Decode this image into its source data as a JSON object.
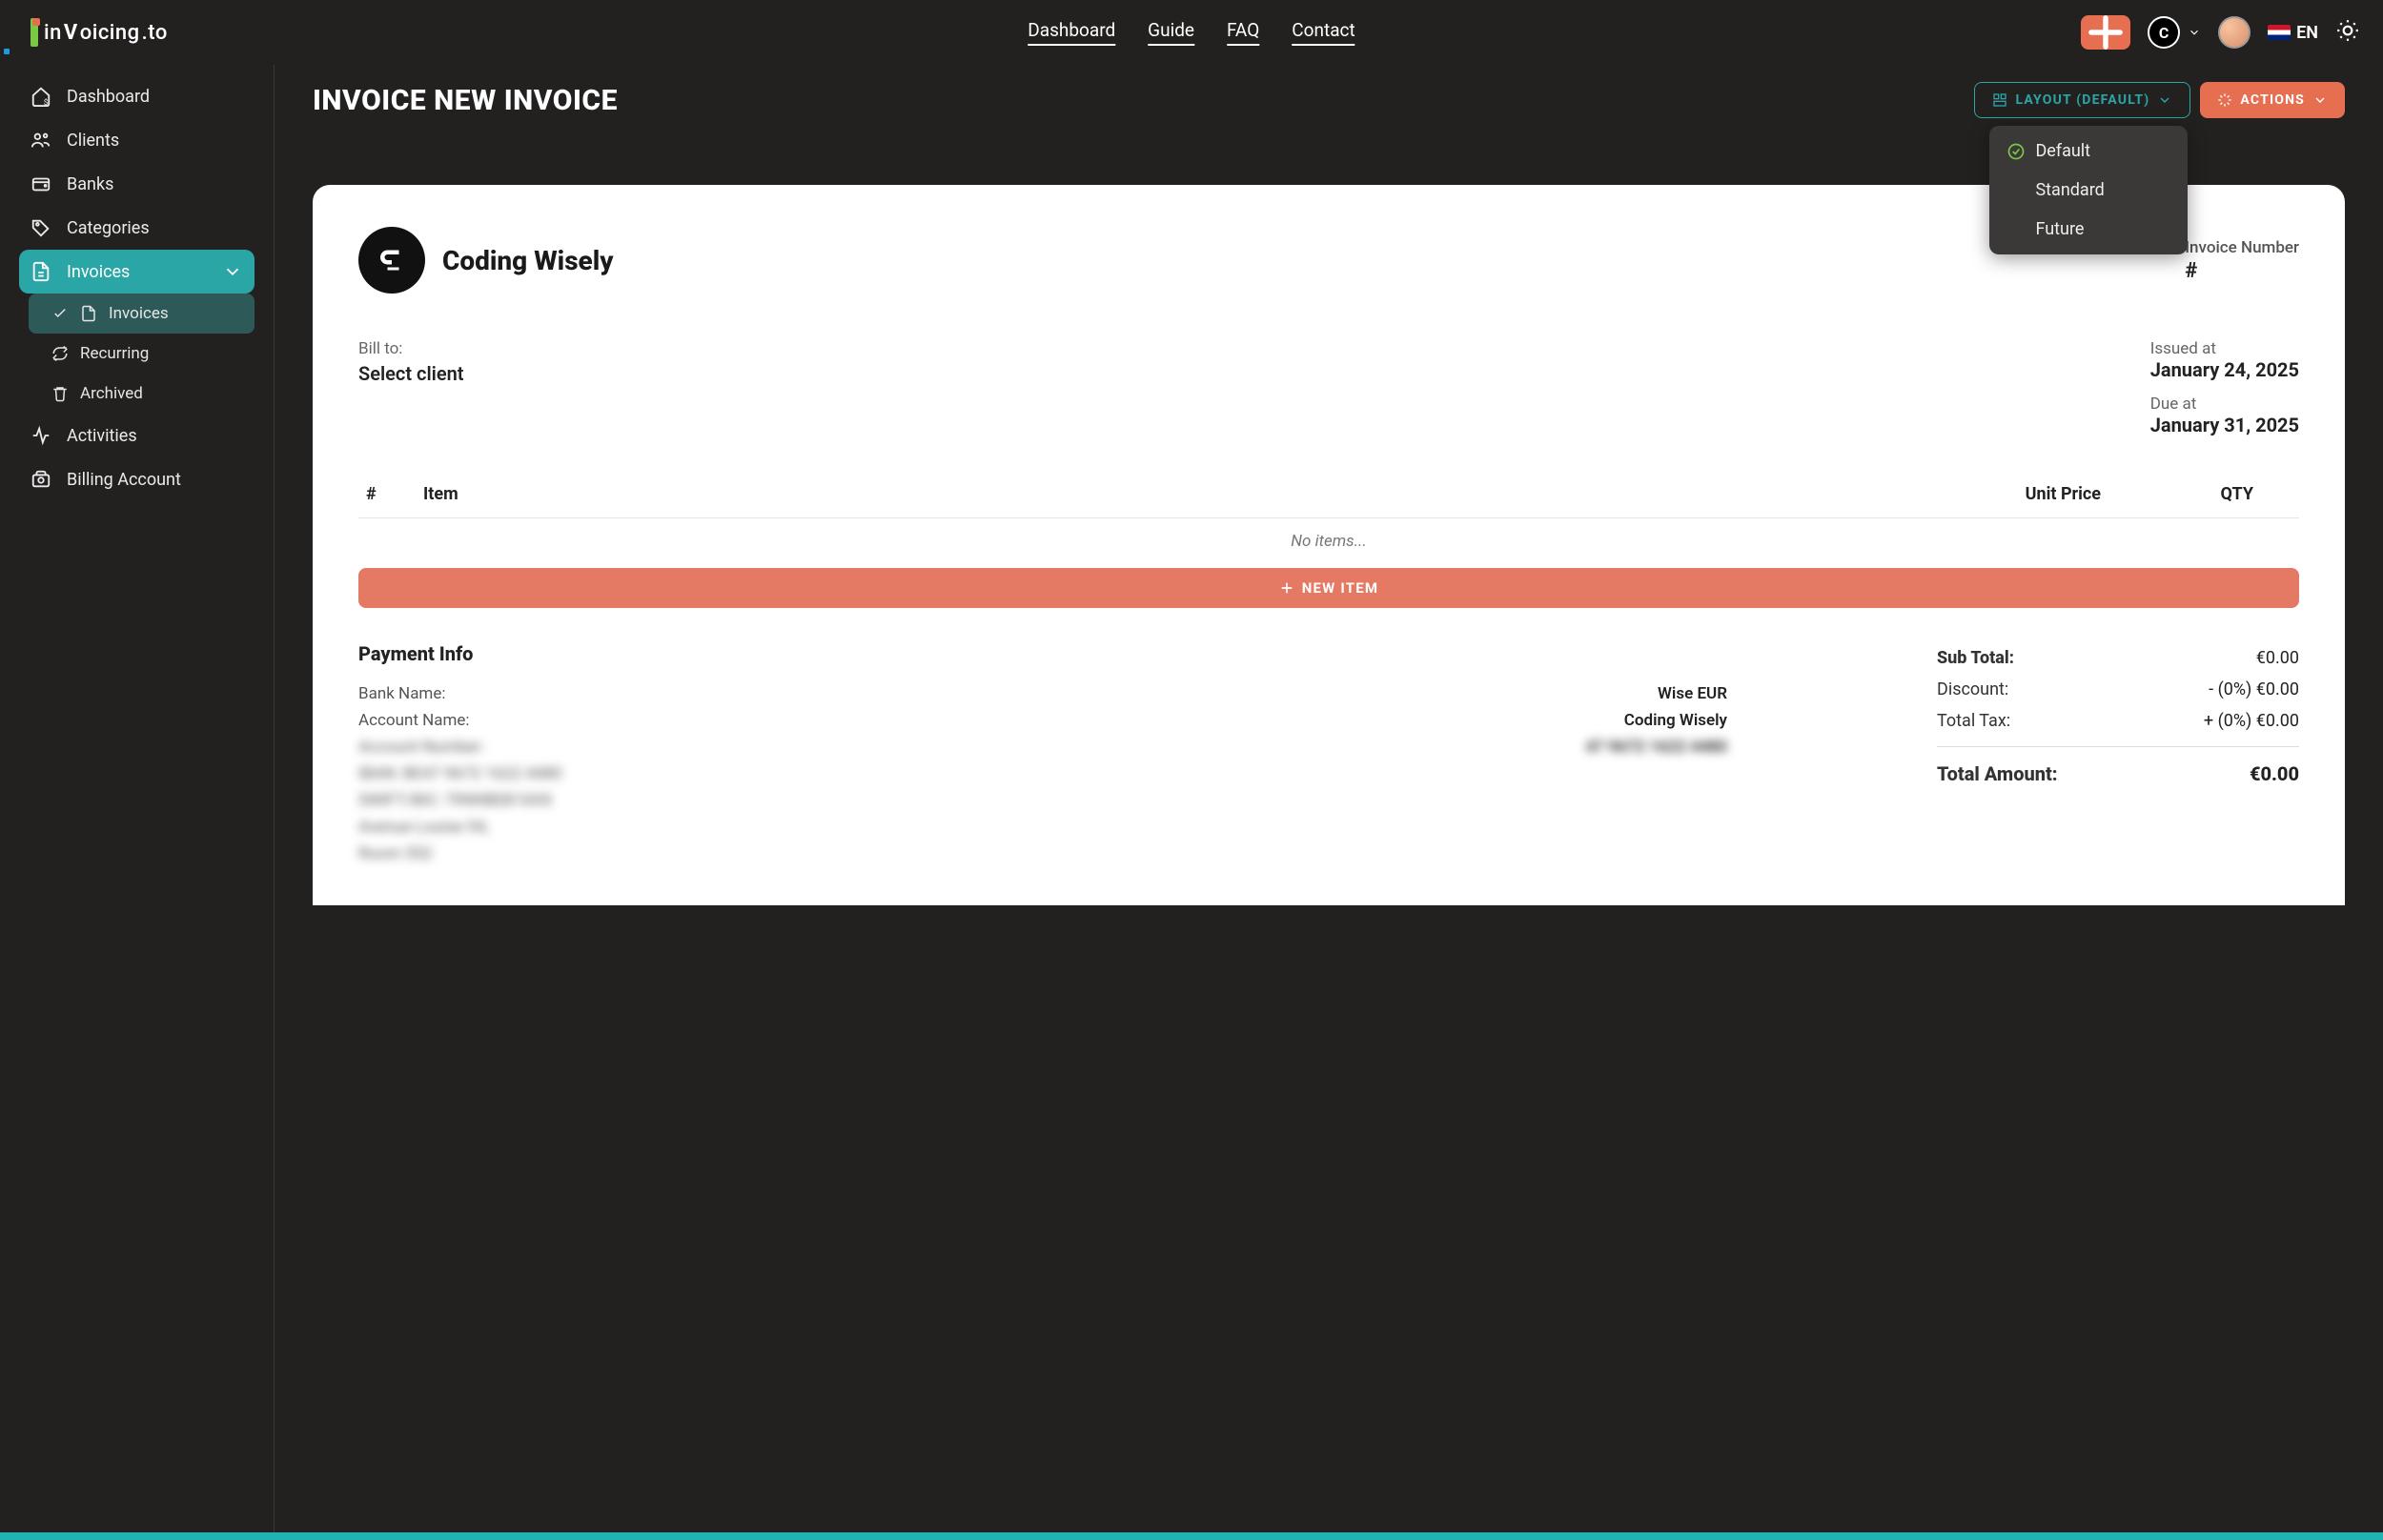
{
  "brand": {
    "name_pre": "in",
    "name_v": "V",
    "name_post": "oicing",
    "tld": ".to"
  },
  "nav": {
    "dashboard": "Dashboard",
    "guide": "Guide",
    "faq": "FAQ",
    "contact": "Contact"
  },
  "topright": {
    "lang": "EN",
    "team_initial": "C"
  },
  "sidebar": {
    "items": [
      {
        "label": "Dashboard"
      },
      {
        "label": "Clients"
      },
      {
        "label": "Banks"
      },
      {
        "label": "Categories"
      },
      {
        "label": "Invoices"
      },
      {
        "label": "Activities"
      },
      {
        "label": "Billing Account"
      }
    ],
    "sub": [
      {
        "label": "Invoices"
      },
      {
        "label": "Recurring"
      },
      {
        "label": "Archived"
      }
    ]
  },
  "page": {
    "title": "INVOICE NEW INVOICE",
    "layout_button": "LAYOUT (DEFAULT)",
    "actions_button": "ACTIONS",
    "layout_options": {
      "default": "Default",
      "standard": "Standard",
      "future": "Future"
    }
  },
  "invoice": {
    "company": "Coding Wisely",
    "invnum_label": "Invoice Number",
    "invnum_value": "#",
    "billto_label": "Bill to:",
    "billto_value": "Select client",
    "issued_label": "Issued at",
    "issued_value": "January 24, 2025",
    "due_label": "Due at",
    "due_value": "January 31, 2025",
    "cols": {
      "hash": "#",
      "item": "Item",
      "price": "Unit Price",
      "qty": "QTY"
    },
    "no_items": "No items...",
    "new_item": "NEW ITEM",
    "payment_heading": "Payment Info",
    "payment": {
      "bank_name_k": "Bank Name:",
      "bank_name_v": "Wise EUR",
      "acct_name_k": "Account Name:",
      "acct_name_v": "Coding Wisely",
      "acct_num_k": "Account Number:",
      "acct_num_v": "47 9672 1622 4480",
      "iban_k": "IBAN: BE47 9672 1622 4480",
      "swift_k": "SWIFT/BIC: TRWIBEB1XXX",
      "addr1": "Avenue Louise 54,",
      "addr2": "Room 552"
    },
    "totals": {
      "subtotal_k": "Sub Total:",
      "subtotal_v": "€0.00",
      "discount_k": "Discount:",
      "discount_v": "- (0%) €0.00",
      "tax_k": "Total Tax:",
      "tax_v": "+ (0%) €0.00",
      "total_k": "Total Amount:",
      "total_v": "€0.00"
    }
  }
}
